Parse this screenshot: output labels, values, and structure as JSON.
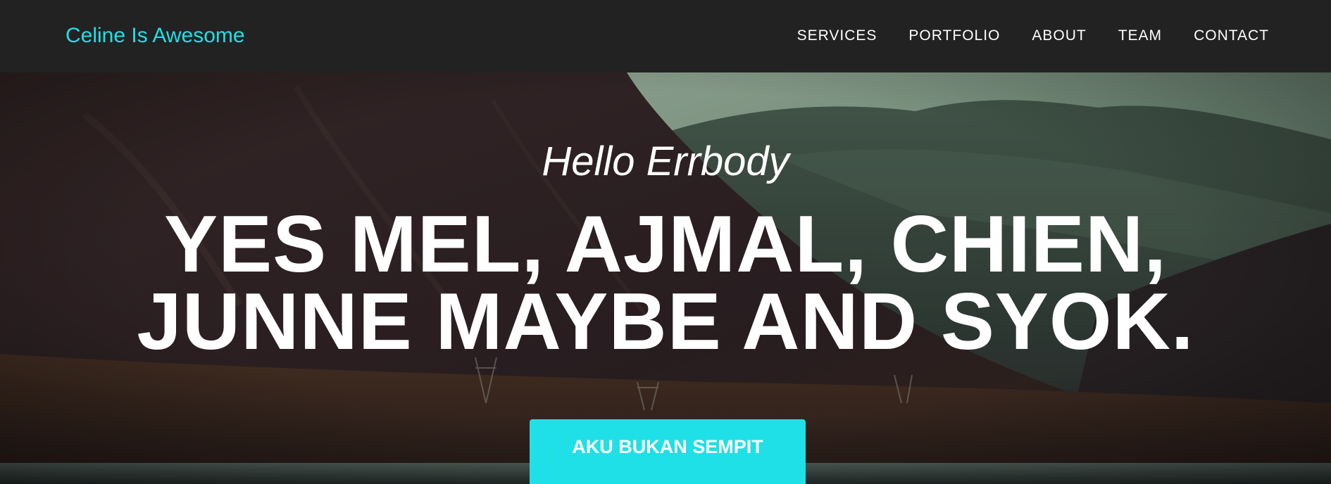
{
  "navbar": {
    "brand": "Celine Is Awesome",
    "links": [
      {
        "label": "SERVICES"
      },
      {
        "label": "PORTFOLIO"
      },
      {
        "label": "ABOUT"
      },
      {
        "label": "TEAM"
      },
      {
        "label": "CONTACT"
      }
    ]
  },
  "hero": {
    "lead_in": "Hello Errbody",
    "heading": "YES MEL, AJMAL, CHIEN, JUNNE MAYBE AND SYOK.",
    "button_label": "AKU BUKAN SEMPIT"
  },
  "colors": {
    "accent": "#1fe0e6",
    "navbar_bg": "#222222",
    "text": "#ffffff"
  }
}
